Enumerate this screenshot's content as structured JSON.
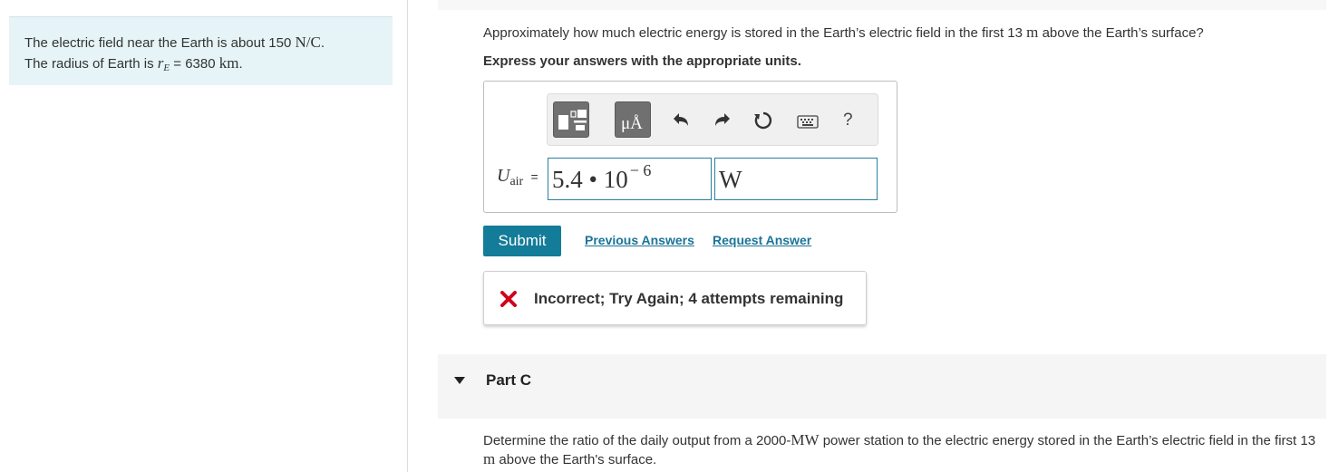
{
  "info": {
    "line1_pre": "The electric field near the Earth is about 150",
    "line1_unit": "N/C",
    "line1_post": ".",
    "line2_pre": "The radius of Earth is",
    "line2_var": "r",
    "line2_sub": "E",
    "line2_mid": "= 6380",
    "line2_unit": "km",
    "line2_post": "."
  },
  "question": {
    "pre": "Approximately how much electric energy is stored in the Earth’s electric field in the first 13",
    "unit": "m",
    "post": "above the Earth’s surface?",
    "instruction": "Express your answers with the appropriate units."
  },
  "toolbar": {
    "templates_icon": "templates-icon",
    "units_label": "μÅ",
    "undo_icon": "undo-icon",
    "redo_icon": "redo-icon",
    "reset_icon": "reset-icon",
    "keyboard_icon": "keyboard-icon",
    "help_label": "?"
  },
  "answer": {
    "var": "U",
    "var_sub": "air",
    "equals": "=",
    "mantissa": "5.4 • 10",
    "exponent": "− 6",
    "unit": "W"
  },
  "actions": {
    "submit_label": "Submit",
    "previous_answers": "Previous Answers",
    "request_answer": "Request Answer"
  },
  "feedback": {
    "icon": "x-icon",
    "color": "#d0021b",
    "message": "Incorrect; Try Again; 4 attempts remaining"
  },
  "part_c": {
    "title": "Part C",
    "q_pre": "Determine the ratio of the daily output from a 2000-",
    "q_unit1": "MW",
    "q_mid": "power station to the electric energy stored in the Earth’s electric field in the first 13",
    "q_unit2": "m",
    "q_post": "above the Earth's surface."
  },
  "colors": {
    "accent": "#137c99",
    "link": "#1a7497",
    "info_bg": "#e6f4f7"
  }
}
